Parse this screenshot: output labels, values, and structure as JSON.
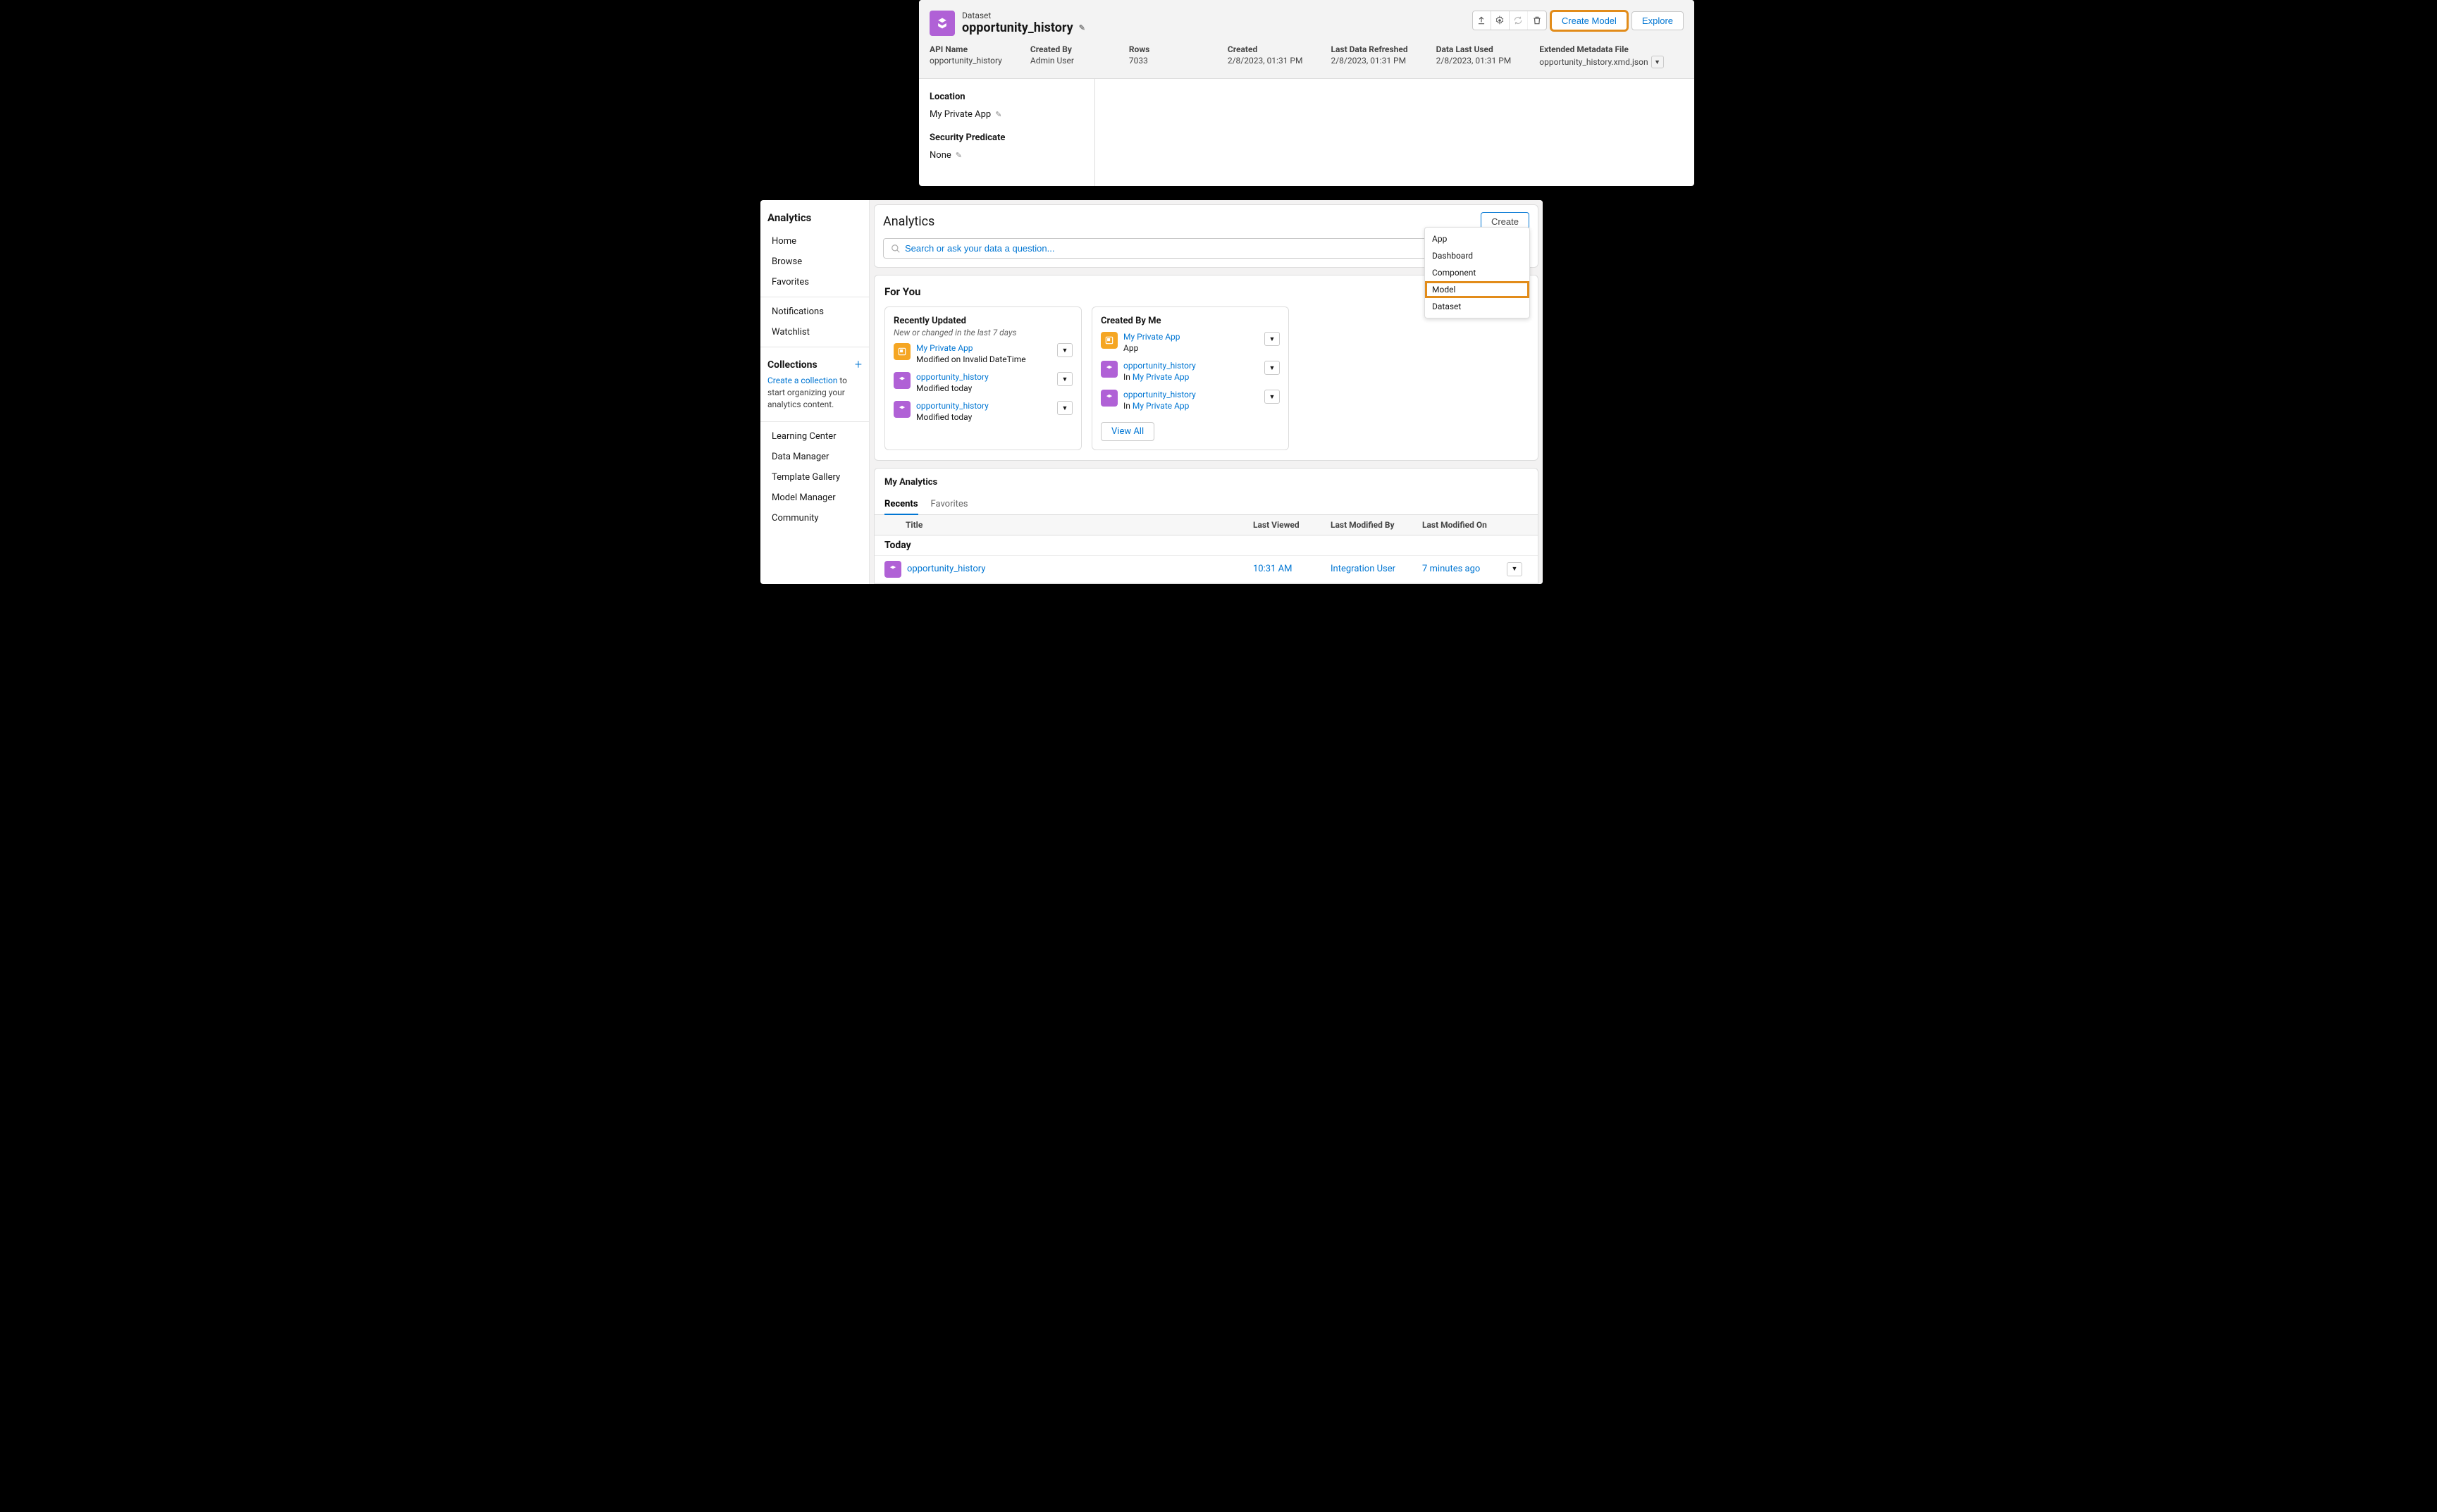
{
  "panel1": {
    "kicker": "Dataset",
    "title": "opportunity_history",
    "actions": {
      "create_model": "Create Model",
      "explore": "Explore"
    },
    "meta": {
      "api_name": {
        "label": "API Name",
        "value": "opportunity_history"
      },
      "created_by": {
        "label": "Created By",
        "value": "Admin User"
      },
      "rows": {
        "label": "Rows",
        "value": "7033"
      },
      "created": {
        "label": "Created",
        "value": "2/8/2023, 01:31 PM"
      },
      "last_refreshed": {
        "label": "Last Data Refreshed",
        "value": "2/8/2023, 01:31 PM"
      },
      "last_used": {
        "label": "Data Last Used",
        "value": "2/8/2023, 01:31 PM"
      },
      "xmd": {
        "label": "Extended Metadata File",
        "value": "opportunity_history.xmd.json"
      }
    },
    "location": {
      "label": "Location",
      "value": "My Private App"
    },
    "predicate": {
      "label": "Security Predicate",
      "value": "None"
    }
  },
  "panel2": {
    "sidebar": {
      "title": "Analytics",
      "nav1": [
        "Home",
        "Browse",
        "Favorites"
      ],
      "nav2": [
        "Notifications",
        "Watchlist"
      ],
      "collections": {
        "title": "Collections",
        "text_pre": "Create a collection",
        "text_post": " to start organizing your analytics content."
      },
      "nav3": [
        "Learning Center",
        "Data Manager",
        "Template Gallery",
        "Model Manager",
        "Community"
      ]
    },
    "header": {
      "title": "Analytics",
      "create": "Create",
      "search_placeholder": "Search or ask your data a question..."
    },
    "create_menu": [
      "App",
      "Dashboard",
      "Component",
      "Model",
      "Dataset"
    ],
    "for_you": {
      "title": "For You",
      "recent": {
        "title": "Recently Updated",
        "subtitle": "New or changed in the last 7 days",
        "items": [
          {
            "icon": "orange",
            "link": "My Private App",
            "sub": "Modified on Invalid DateTime"
          },
          {
            "icon": "purple",
            "link": "opportunity_history",
            "sub": "Modified today"
          },
          {
            "icon": "purple",
            "link": "opportunity_history",
            "sub": "Modified today"
          }
        ]
      },
      "created": {
        "title": "Created By Me",
        "items": [
          {
            "icon": "orange",
            "link": "My Private App",
            "sub_pre": "App",
            "sub_link": ""
          },
          {
            "icon": "purple",
            "link": "opportunity_history",
            "sub_pre": "In ",
            "sub_link": "My Private App"
          },
          {
            "icon": "purple",
            "link": "opportunity_history",
            "sub_pre": "In ",
            "sub_link": "My Private App"
          }
        ],
        "view_all": "View All"
      }
    },
    "my_analytics": {
      "title": "My Analytics",
      "tabs": [
        "Recents",
        "Favorites"
      ],
      "columns": {
        "title": "Title",
        "lv": "Last Viewed",
        "lmb": "Last Modified By",
        "lmo": "Last Modified On"
      },
      "group": "Today",
      "row": {
        "title": "opportunity_history",
        "lv": "10:31 AM",
        "lmb": "Integration User",
        "lmo": "7 minutes ago"
      }
    }
  }
}
